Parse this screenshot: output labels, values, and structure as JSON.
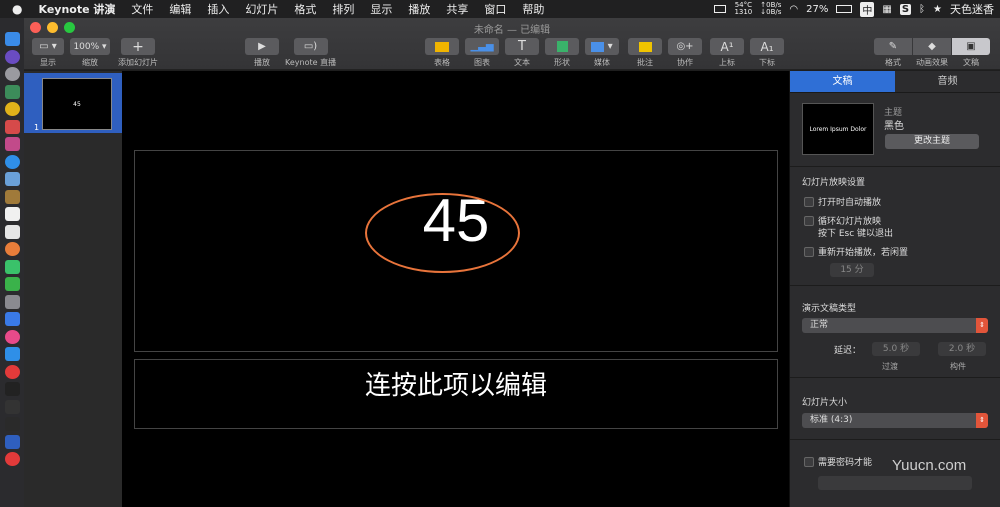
{
  "menubar": {
    "app": "Keynote 讲演",
    "items": [
      "文件",
      "编辑",
      "插入",
      "幻灯片",
      "格式",
      "排列",
      "显示",
      "播放",
      "共享",
      "窗口",
      "帮助"
    ],
    "temp_value": "54°C",
    "temp_rpm": "1310",
    "net_up": "0B/s",
    "net_down": "0B/s",
    "battery": "27%",
    "input_method": "中",
    "user": "天色迷香"
  },
  "window": {
    "title": "未命名 — 已编辑"
  },
  "toolbar": {
    "view_label": "显示",
    "zoom_value": "100%",
    "zoom_label": "缩放",
    "add_slide_label": "添加幻灯片",
    "play_label": "播放",
    "keynote_live_label": "Keynote 直播",
    "table_label": "表格",
    "chart_label": "图表",
    "text_label": "文本",
    "shape_label": "形状",
    "media_label": "媒体",
    "comment_label": "批注",
    "collaborate_label": "协作",
    "superscript_label": "上标",
    "subscript_label": "下标",
    "format_label": "格式",
    "animate_label": "动画效果",
    "document_label": "文稿",
    "text_glyph": "T",
    "superscript_glyph": "A¹",
    "subscript_glyph": "A₁"
  },
  "navigator": {
    "slide_number": "1",
    "thumb_text": "45"
  },
  "slide": {
    "title_text": "45",
    "body_text": "连按此项以编辑",
    "accent_color": "#e8743b"
  },
  "inspector": {
    "tab_document": "文稿",
    "tab_audio": "音频",
    "theme_preview_title": "Lorem Ipsum Dolor",
    "theme_label": "主题",
    "theme_name": "黑色",
    "change_theme_button": "更改主题",
    "slideshow_settings": "幻灯片放映设置",
    "autoplay": "打开时自动播放",
    "loop": "循环幻灯片放映",
    "loop_hint": "按下 Esc 键以退出",
    "restart_idle": "重新开始播放，若闲置",
    "idle_minutes": "15 分",
    "presentation_type": "演示文稿类型",
    "presentation_type_value": "正常",
    "delay_label": "延迟：",
    "transition_delay": "5.0 秒",
    "build_delay": "2.0 秒",
    "transition_label": "过渡",
    "build_label": "构件",
    "slide_size": "幻灯片大小",
    "slide_size_value": "标准 (4:3)",
    "require_password": "需要密码才能",
    "watermark": "Yuucn.com"
  }
}
